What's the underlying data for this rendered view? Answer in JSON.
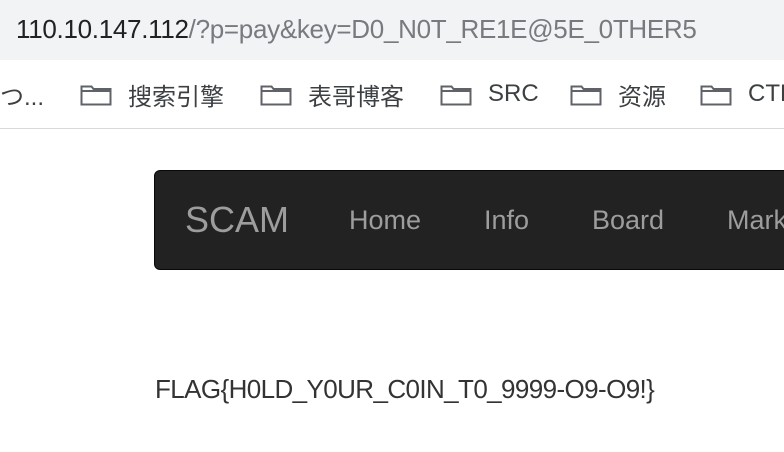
{
  "browser": {
    "url_host": "110.10.147.112",
    "url_path": "/?p=pay&key=D0_N0T_RE1E@5E_0THER5"
  },
  "bookmarks": {
    "truncated_item": "つ...",
    "items": [
      {
        "label": "搜索引擎",
        "icon": "folder-icon"
      },
      {
        "label": "表哥博客",
        "icon": "folder-icon"
      },
      {
        "label": "SRC",
        "icon": "folder-icon"
      },
      {
        "label": "资源",
        "icon": "folder-icon"
      },
      {
        "label": "CTF",
        "icon": "folder-icon"
      }
    ]
  },
  "navbar": {
    "brand": "SCAM",
    "links": [
      "Home",
      "Info",
      "Board",
      "Market"
    ]
  },
  "content": {
    "flag": "FLAG{H0LD_Y0UR_C0IN_T0_9999-O9-O9!}"
  },
  "colors": {
    "navbar_bg": "#222222",
    "navbar_text": "#9d9d9d",
    "address_bar_bg": "#f1f3f4"
  }
}
